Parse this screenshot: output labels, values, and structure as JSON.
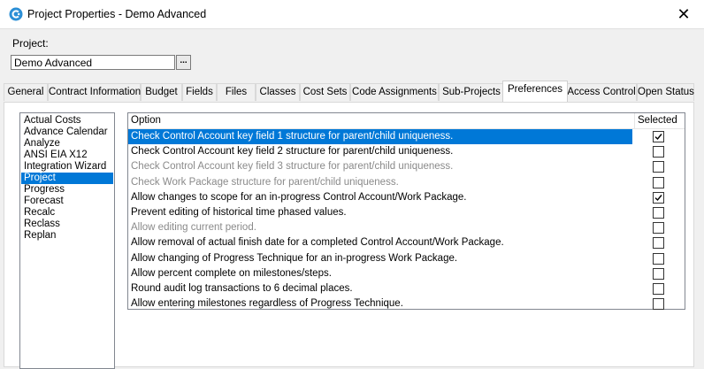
{
  "window": {
    "title": "Project Properties - Demo Advanced",
    "close_glyph": "✕",
    "icon": "app-logo-icon"
  },
  "project": {
    "label": "Project:",
    "value": "Demo Advanced",
    "browse_label": "..."
  },
  "tabs": [
    {
      "label": "General",
      "active": false
    },
    {
      "label": "Contract Information",
      "active": false
    },
    {
      "label": "Budget",
      "active": false
    },
    {
      "label": "Fields",
      "active": false
    },
    {
      "label": "Files",
      "active": false
    },
    {
      "label": "Classes",
      "active": false
    },
    {
      "label": "Cost Sets",
      "active": false
    },
    {
      "label": "Code Assignments",
      "active": false
    },
    {
      "label": "Sub-Projects",
      "active": false
    },
    {
      "label": "Preferences",
      "active": true
    },
    {
      "label": "Access Control",
      "active": false
    },
    {
      "label": "Open Status",
      "active": false
    }
  ],
  "categories": [
    {
      "label": "Actual Costs",
      "selected": false
    },
    {
      "label": "Advance Calendar",
      "selected": false
    },
    {
      "label": "Analyze",
      "selected": false
    },
    {
      "label": "ANSI EIA X12",
      "selected": false
    },
    {
      "label": "Integration Wizard",
      "selected": false
    },
    {
      "label": "Project",
      "selected": true
    },
    {
      "label": "Progress",
      "selected": false
    },
    {
      "label": "Forecast",
      "selected": false
    },
    {
      "label": "Recalc",
      "selected": false
    },
    {
      "label": "Reclass",
      "selected": false
    },
    {
      "label": "Replan",
      "selected": false
    }
  ],
  "grid": {
    "columns": {
      "option": "Option",
      "selected": "Selected"
    },
    "rows": [
      {
        "option": "Check Control Account key field 1 structure for parent/child uniqueness.",
        "checked": true,
        "enabled": true,
        "selected": true
      },
      {
        "option": "Check Control Account key field 2 structure for parent/child uniqueness.",
        "checked": false,
        "enabled": true,
        "selected": false
      },
      {
        "option": "Check Control Account key field 3 structure for parent/child uniqueness.",
        "checked": false,
        "enabled": false,
        "selected": false
      },
      {
        "option": "Check Work Package structure for parent/child uniqueness.",
        "checked": false,
        "enabled": false,
        "selected": false
      },
      {
        "option": "Allow changes to scope for an in-progress Control Account/Work Package.",
        "checked": true,
        "enabled": true,
        "selected": false
      },
      {
        "option": "Prevent editing of historical time phased values.",
        "checked": false,
        "enabled": true,
        "selected": false
      },
      {
        "option": "Allow editing current period.",
        "checked": false,
        "enabled": false,
        "selected": false
      },
      {
        "option": "Allow removal of actual finish date for a completed Control Account/Work Package.",
        "checked": false,
        "enabled": true,
        "selected": false
      },
      {
        "option": "Allow changing of Progress Technique for an in-progress Work Package.",
        "checked": false,
        "enabled": true,
        "selected": false
      },
      {
        "option": "Allow percent complete on milestones/steps.",
        "checked": false,
        "enabled": true,
        "selected": false
      },
      {
        "option": "Round audit log transactions to 6 decimal places.",
        "checked": false,
        "enabled": true,
        "selected": false
      },
      {
        "option": "Allow entering milestones regardless of Progress Technique.",
        "checked": false,
        "enabled": true,
        "selected": false
      }
    ]
  },
  "colors": {
    "selection": "#0078d7",
    "disabled_text": "#8a8a8a",
    "app_icon": "#2b8fd6"
  }
}
